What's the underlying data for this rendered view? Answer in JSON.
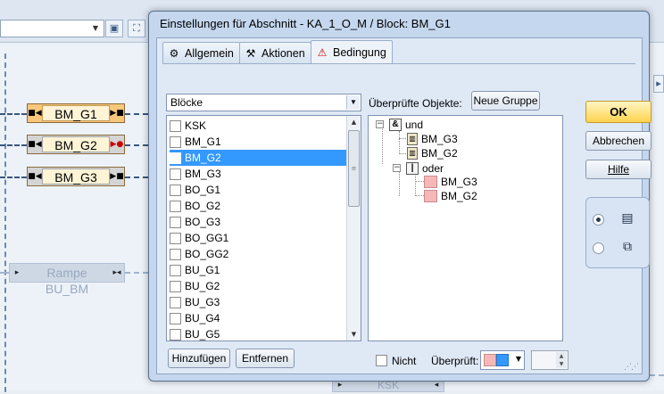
{
  "background": {
    "blocks": [
      {
        "label": "BM_G1"
      },
      {
        "label": "BM_G2"
      },
      {
        "label": "BM_G3"
      },
      {
        "label": "Rampe BU_BM"
      },
      {
        "label": "KSK"
      }
    ]
  },
  "dialog": {
    "title": "Einstellungen für Abschnitt - KA_1_O_M / Block: BM_G1",
    "tabs": [
      {
        "label": "Allgemein",
        "icon": "settings-icon"
      },
      {
        "label": "Aktionen",
        "icon": "actions-icon"
      },
      {
        "label": "Bedingung",
        "icon": "condition-icon",
        "active": true
      }
    ],
    "object_type": {
      "selected": "Blöcke"
    },
    "objects": [
      {
        "label": "KSK",
        "selected": false
      },
      {
        "label": "BM_G1",
        "selected": false
      },
      {
        "label": "BM_G2",
        "selected": true
      },
      {
        "label": "BM_G3",
        "selected": false
      },
      {
        "label": "BO_G1",
        "selected": false
      },
      {
        "label": "BO_G2",
        "selected": false
      },
      {
        "label": "BO_G3",
        "selected": false
      },
      {
        "label": "BO_GG1",
        "selected": false
      },
      {
        "label": "BO_GG2",
        "selected": false
      },
      {
        "label": "BU_G1",
        "selected": false
      },
      {
        "label": "BU_G2",
        "selected": false
      },
      {
        "label": "BU_G3",
        "selected": false
      },
      {
        "label": "BU_G4",
        "selected": false
      },
      {
        "label": "BU_G5",
        "selected": false
      }
    ],
    "checked_objects_label": "Überprüfte Objekte:",
    "new_group_label": "Neue Gruppe",
    "tree": {
      "and_label": "und",
      "and_symbol": "&",
      "and_children": [
        "BM_G3",
        "BM_G2"
      ],
      "or_label": "oder",
      "or_symbol": "|",
      "or_children": [
        "BM_G3",
        "BM_G2"
      ]
    },
    "buttons": {
      "ok": "OK",
      "cancel": "Abbrechen",
      "help": "Hilfe",
      "add": "Hinzufügen",
      "remove": "Entfernen"
    },
    "view_options": [
      {
        "icon": "list-view-icon",
        "selected": true
      },
      {
        "icon": "grid-view-icon",
        "selected": false
      }
    ],
    "not_label": "Nicht",
    "checked_by_label": "Überprüft:",
    "colors": {
      "pink": "#f5b7b7",
      "blue": "#3399ff",
      "ok_button": "#ffd34e"
    }
  }
}
